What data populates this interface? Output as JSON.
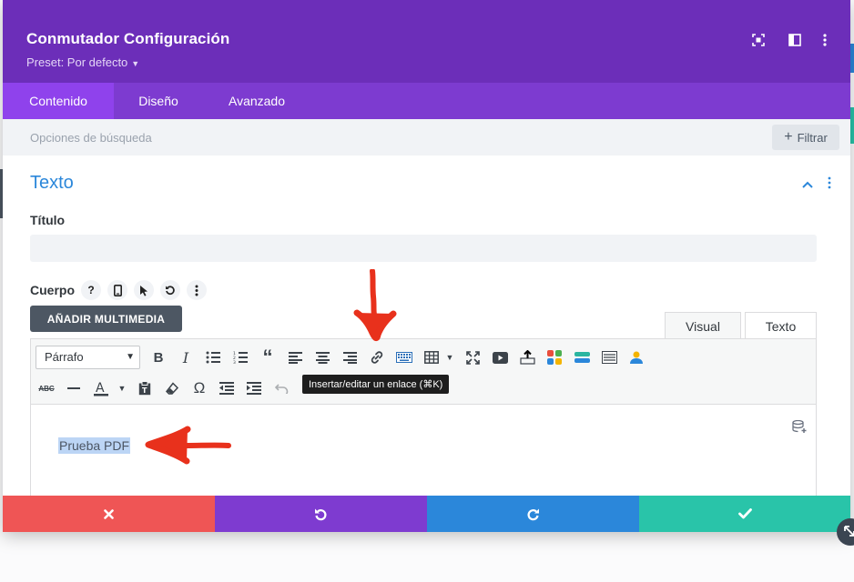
{
  "header": {
    "title": "Conmutador Configuración",
    "preset": "Preset: Por defecto",
    "icons": [
      "expand-icon",
      "split-view-icon",
      "more-vert-icon"
    ],
    "color": "#6c2eb9"
  },
  "tabs": [
    {
      "label": "Contenido",
      "active": true
    },
    {
      "label": "Diseño",
      "active": false
    },
    {
      "label": "Avanzado",
      "active": false
    }
  ],
  "search": {
    "placeholder": "Opciones de búsqueda",
    "filter_label": "Filtrar"
  },
  "section": {
    "title": "Texto",
    "title_label": "Título",
    "title_value": "",
    "body_label": "Cuerpo"
  },
  "editor": {
    "add_media": "AÑADIR MULTIMEDIA",
    "mode_visual": "Visual",
    "mode_text": "Texto",
    "format_select": "Párrafo",
    "tooltip": "Insertar/editar un enlace (⌘K)",
    "content": "Prueba PDF"
  },
  "footer": {
    "colors": {
      "cancel": "#ef5555",
      "undo": "#7e3bd0",
      "redo": "#2b87da",
      "save": "#29c4a9"
    }
  }
}
